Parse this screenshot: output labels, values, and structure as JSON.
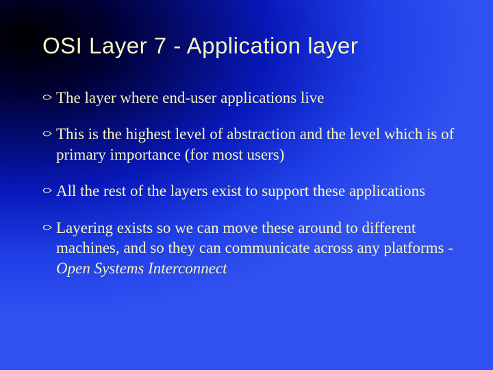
{
  "slide": {
    "title": "OSI Layer 7 - Application layer",
    "bullets": [
      {
        "text": "The layer where end-user applications live"
      },
      {
        "text": "This is the highest level of abstraction and the level which is of primary importance (for most users)"
      },
      {
        "text": "All the rest of the layers exist to support these applications"
      },
      {
        "text_prefix": "Layering exists so we can move these around to different machines, and so they can communicate across any platforms - ",
        "text_italic": "Open Systems Interconnect"
      }
    ]
  }
}
